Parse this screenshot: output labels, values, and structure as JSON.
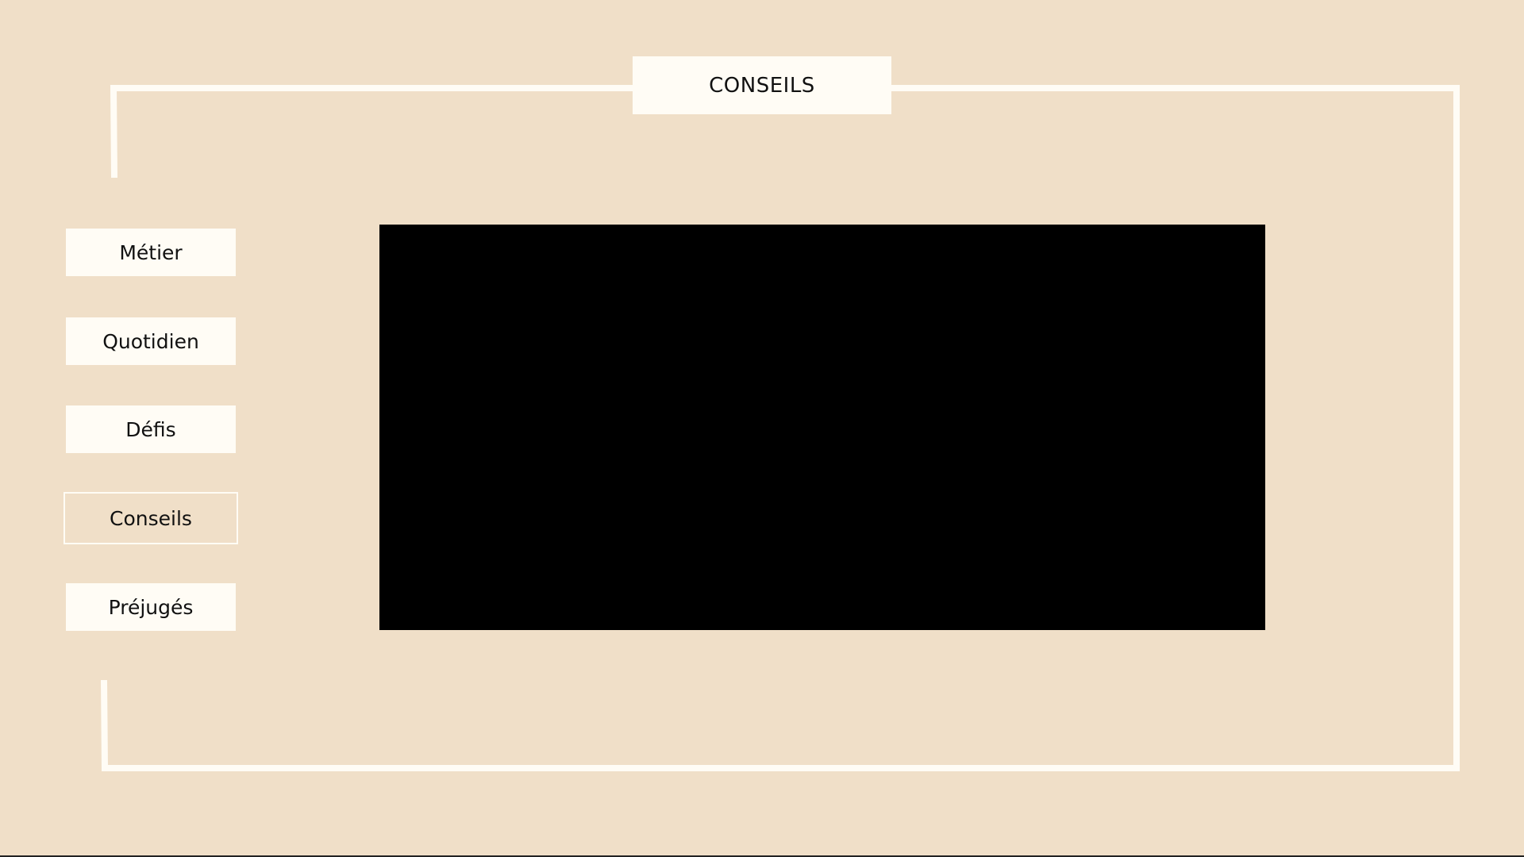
{
  "header": {
    "title": "CONSEILS"
  },
  "nav": {
    "items": [
      {
        "label": "Métier",
        "active": false
      },
      {
        "label": "Quotidien",
        "active": false
      },
      {
        "label": "Défis",
        "active": false
      },
      {
        "label": "Conseils",
        "active": true
      },
      {
        "label": "Préjugés",
        "active": false
      }
    ]
  },
  "colors": {
    "background": "#f0dfc8",
    "panel": "#fffcf5",
    "video": "#000000",
    "text": "#111111"
  }
}
